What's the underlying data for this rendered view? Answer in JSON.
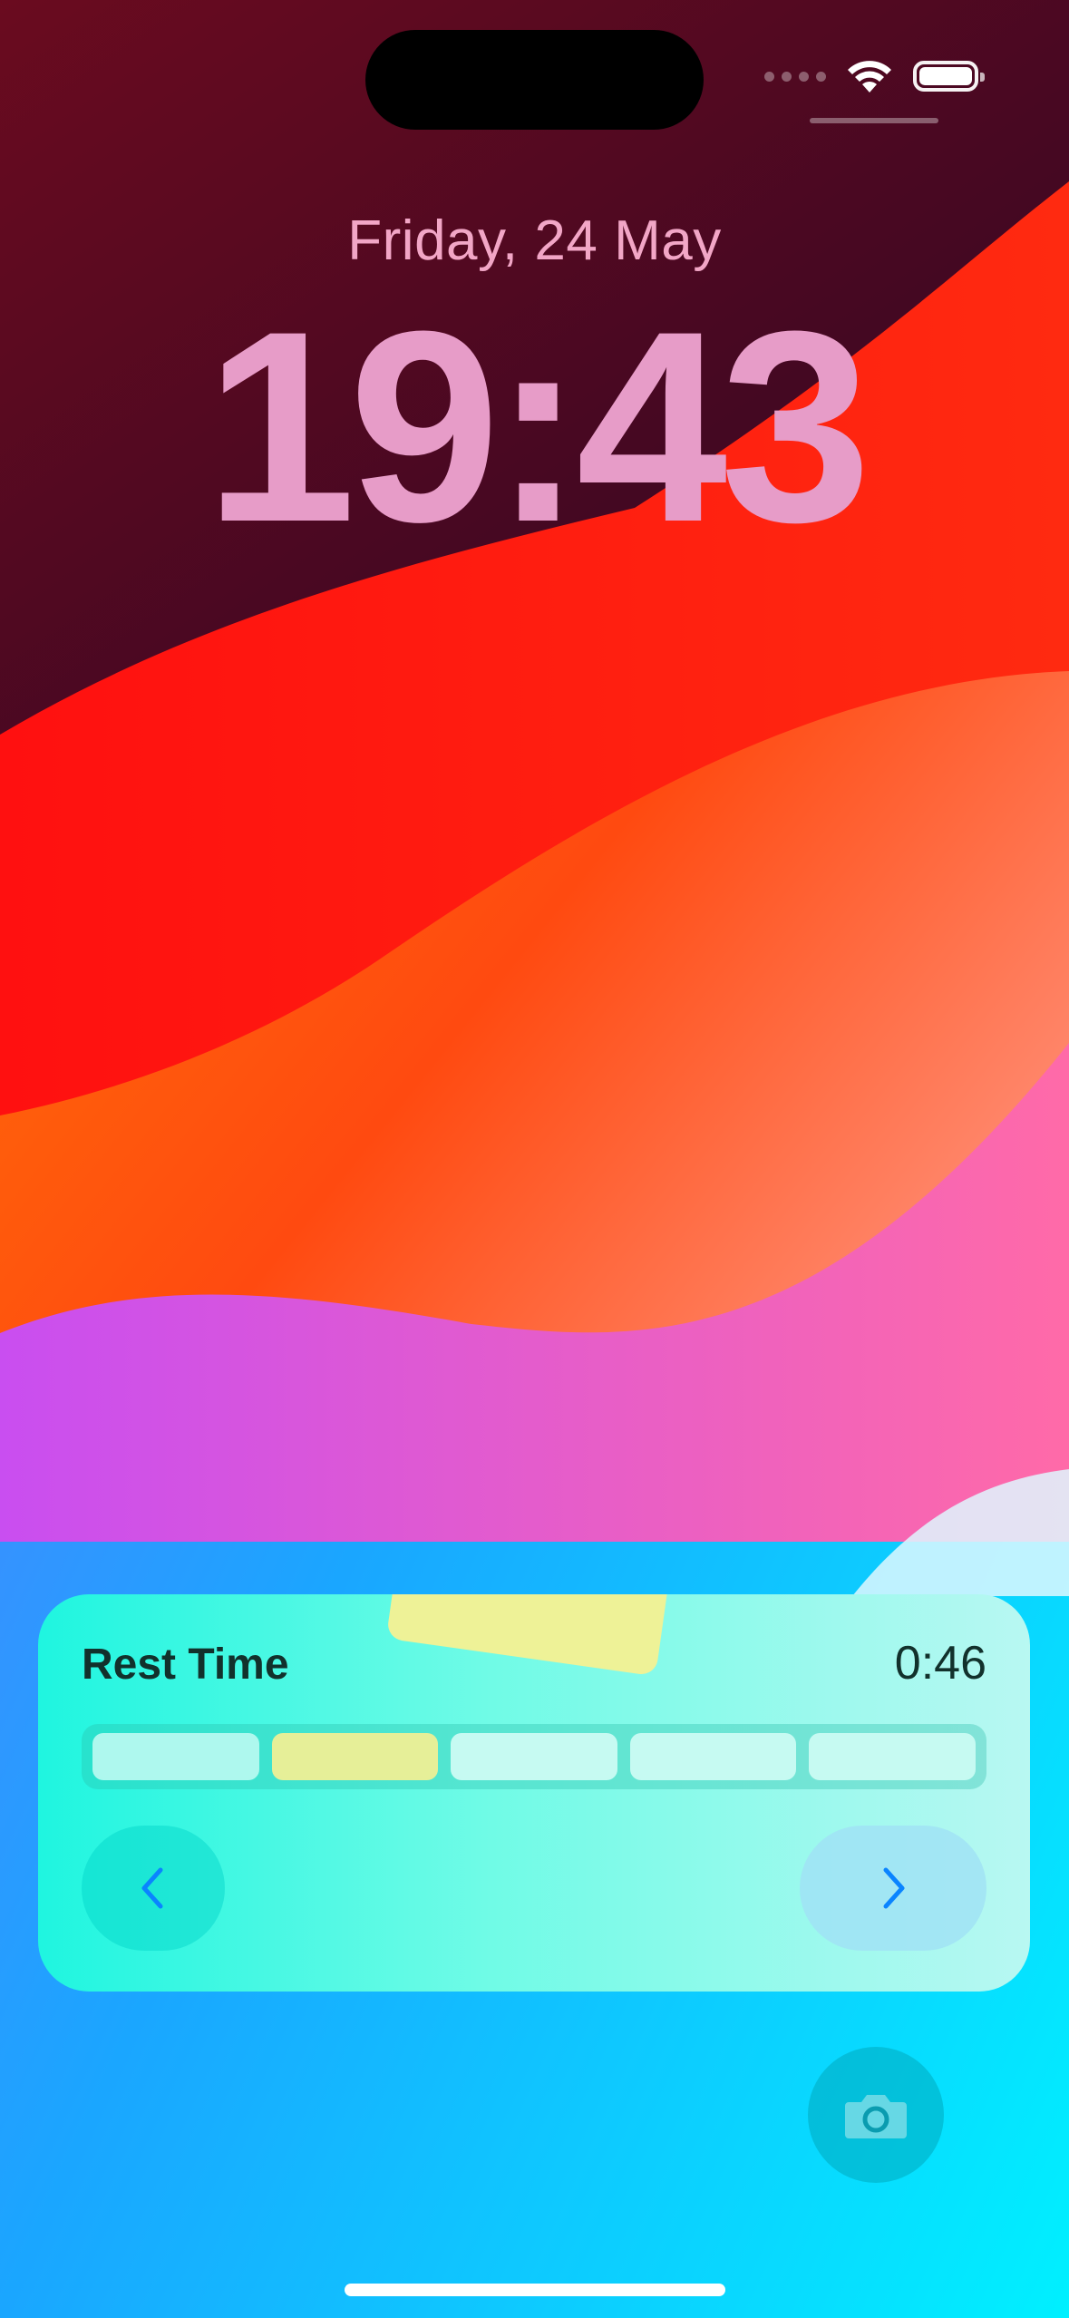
{
  "lockscreen": {
    "date": "Friday, 24 May",
    "time": "19:43"
  },
  "status_bar": {
    "icons": [
      "signal-dots-icon",
      "wifi-icon",
      "battery-icon"
    ],
    "battery_level": 1.0
  },
  "widget": {
    "title": "Rest Time",
    "timer": "0:46",
    "progress_segments": 5,
    "active_segment": 2,
    "prev_icon": "chevron-left-icon",
    "next_icon": "chevron-right-icon"
  },
  "quick_actions": {
    "camera_icon": "camera-icon"
  },
  "colors": {
    "accent": "#0a84ff",
    "widget_bg": "#6ffbe6",
    "active_segment": "#e6ef98"
  }
}
